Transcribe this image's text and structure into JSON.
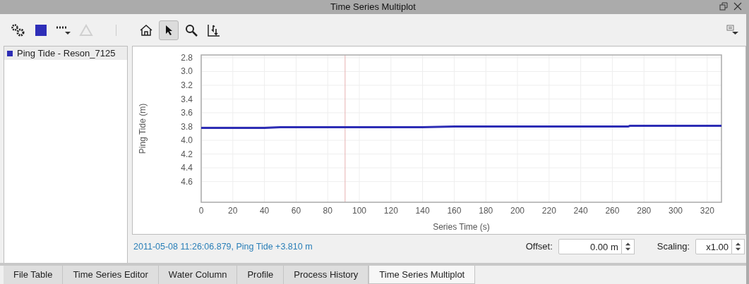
{
  "window": {
    "title": "Time Series Multiplot"
  },
  "toolbar": [
    {
      "kind": "settings",
      "selected": false
    },
    {
      "kind": "color",
      "selected": false
    },
    {
      "kind": "line-style",
      "selected": false
    },
    {
      "kind": "triangle",
      "selected": false,
      "disabled": true
    },
    {
      "kind": "separator"
    },
    {
      "kind": "home",
      "selected": false
    },
    {
      "kind": "pointer",
      "selected": true
    },
    {
      "kind": "zoom",
      "selected": false
    },
    {
      "kind": "export",
      "selected": false
    }
  ],
  "chart": {
    "chart_data": {
      "type": "line",
      "xlabel": "Series Time (s)",
      "ylabel": "Ping Tide (m)",
      "x": [
        0,
        10,
        20,
        30,
        40,
        50,
        60,
        70,
        80,
        91,
        100,
        120,
        140,
        160,
        180,
        200,
        220,
        240,
        260,
        270,
        271,
        290,
        310,
        329
      ],
      "series": [
        {
          "name": "Ping Tide - Reson_7125",
          "color": "#2d2db5",
          "values": [
            3.82,
            3.82,
            3.82,
            3.82,
            3.82,
            3.81,
            3.81,
            3.81,
            3.81,
            3.81,
            3.81,
            3.81,
            3.81,
            3.8,
            3.8,
            3.8,
            3.8,
            3.8,
            3.8,
            3.8,
            3.79,
            3.79,
            3.79,
            3.79
          ]
        }
      ],
      "xlim": [
        0,
        329
      ],
      "ylim": [
        4.9,
        2.76
      ],
      "xticks": [
        0,
        20,
        40,
        60,
        80,
        100,
        120,
        140,
        160,
        180,
        200,
        220,
        240,
        260,
        280,
        300,
        320
      ],
      "yticks": [
        2.8,
        {
          "value": 3,
          "label": "3.0"
        },
        3.2,
        3.4,
        3.6,
        3.8,
        {
          "value": 4,
          "label": "4.0"
        },
        4.2,
        4.4,
        4.6
      ],
      "grid": true,
      "ref_lines": [
        {
          "axis": "x",
          "value": 91,
          "color": "#e7b0b0"
        }
      ]
    }
  },
  "status": "2011-05-08 11:26:06.879, Ping Tide +3.810 m",
  "offset": {
    "label": "Offset:",
    "value": "0.00 m"
  },
  "scaling": {
    "label": "Scaling:",
    "value": "x1.00"
  },
  "tabs": [
    {
      "label": "File Table",
      "selected": false
    },
    {
      "label": "Time Series Editor",
      "selected": false
    },
    {
      "label": "Water Column",
      "selected": false
    },
    {
      "label": "Profile",
      "selected": false
    },
    {
      "label": "Process History",
      "selected": false
    },
    {
      "label": "Time Series Multiplot",
      "selected": true
    }
  ]
}
